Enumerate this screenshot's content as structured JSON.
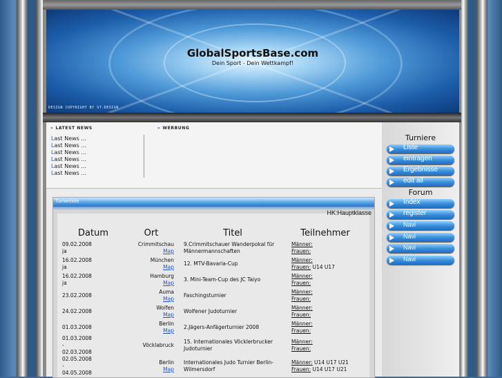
{
  "site": {
    "title": "GlobalSportsBase.com",
    "slogan": "Dein Sport - Dein Wettkampf!",
    "copyright": "DESIGN COPYRIGHT BY ST-DESIGN"
  },
  "news": {
    "latest_header": "LATEST NEWS",
    "ads_header": "WERBUNG",
    "items": [
      "Last News ...",
      "Last News ...",
      "Last News ...",
      "Last News ...",
      "Last News ...",
      "Last News ..."
    ]
  },
  "sidebar": {
    "turniere_title": "Turniere",
    "turniere": [
      "Liste",
      "eintragen",
      "Ergebnisse",
      "edit all"
    ],
    "forum_title": "Forum",
    "forum": [
      "Index",
      "register",
      "Navi",
      "Navi",
      "Navi",
      "Navi"
    ]
  },
  "tournament_list": {
    "title": "Turnierliste",
    "class_label": "HK:Hauptklasse",
    "columns": [
      "Datum",
      "Ort",
      "Titel",
      "Teilnehmer"
    ],
    "map_label": "Map",
    "rows": [
      {
        "date": "09.02.2008",
        "date2": "ja",
        "place": "Crimmitschau",
        "title": "9.Crimmitschauer Wanderpokal für Männermannschaften",
        "men": "Männer:",
        "men_ext": "",
        "women": "Frauen:",
        "women_ext": ""
      },
      {
        "date": "16.02.2008",
        "date2": "ja",
        "place": "München",
        "title": "12. MTV-Bavaria-Cup",
        "men": "Männer:",
        "men_ext": "",
        "women": "Frauen:",
        "women_ext": " U14 U17"
      },
      {
        "date": "16.02.2008",
        "date2": "ja",
        "place": "Hamburg",
        "title": "3. Mini-Team-Cup des JC Taiyo",
        "men": "Männer:",
        "men_ext": "",
        "women": "Frauen:",
        "women_ext": ""
      },
      {
        "date": "23.02.2008",
        "date2": "",
        "place": "Auma",
        "title": "Faschingsturnier",
        "men": "Männer:",
        "men_ext": "",
        "women": "Frauen:",
        "women_ext": ""
      },
      {
        "date": "24.02.2008",
        "date2": "",
        "place": "Wolfen",
        "title": "Wolfener Judoturnier",
        "men": "Männer:",
        "men_ext": "",
        "women": "Frauen:",
        "women_ext": ""
      },
      {
        "date": "01.03.2008",
        "date2": "",
        "place": "Berlin",
        "title": "2.Jägers-Anfägerturnier 2008",
        "men": "Männer:",
        "men_ext": "",
        "women": "Frauen:",
        "women_ext": ""
      },
      {
        "date": "01.03.2008",
        "date2": "-",
        "date3": "02.03.2008",
        "place": "Vöcklabruck",
        "title": "15. Internationales Vöcklerbrucker Judoturnier",
        "men": "Männer:",
        "men_ext": "",
        "women": "Frauen:",
        "women_ext": ""
      },
      {
        "date": "02.05.2008",
        "date2": "-",
        "date3": "04.05.2008",
        "place": "Berlin",
        "title": "Internationales Judo Turnier Berlin-Wilmersdorf",
        "men": "Männer:",
        "men_ext": " U14 U17 U21",
        "women": "Frauen:",
        "women_ext": " U14 U17 U21"
      }
    ]
  },
  "colors": {
    "accent": "#3b8fdc",
    "link": "#2255cc",
    "banner": "#4f9ad8"
  }
}
